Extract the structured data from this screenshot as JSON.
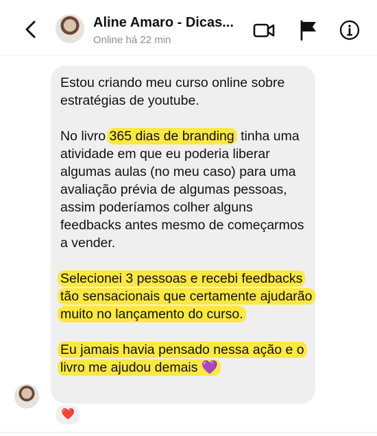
{
  "header": {
    "contact_name": "Aline Amaro - Dicas...",
    "status": "Online há 22 min",
    "icons": [
      "back-chevron-icon",
      "video-camera-icon",
      "flag-icon",
      "info-icon"
    ]
  },
  "message": {
    "p1": "Estou criando meu curso online sobre estratégias de youtube.",
    "p2_a": "No livro ",
    "p2_highlight": "365 dias de branding",
    "p2_b": " tinha uma atividade em que eu poderia liberar algumas aulas (no meu caso) para uma avaliação prévia de algumas pessoas, assim poderíamos colher alguns feedbacks antes mesmo de começarmos a vender.",
    "p3": "Selecionei 3 pessoas e recebi feedbacks tão sensacionais que certamente ajudarão muito no lançamento do curso.",
    "p4": "Eu jamais havia pensado nessa ação e o livro me ajudou demais 💜",
    "highlight_color": "#fbe843",
    "bubble_color": "#efefef"
  },
  "reaction": {
    "emoji": "❤️"
  }
}
